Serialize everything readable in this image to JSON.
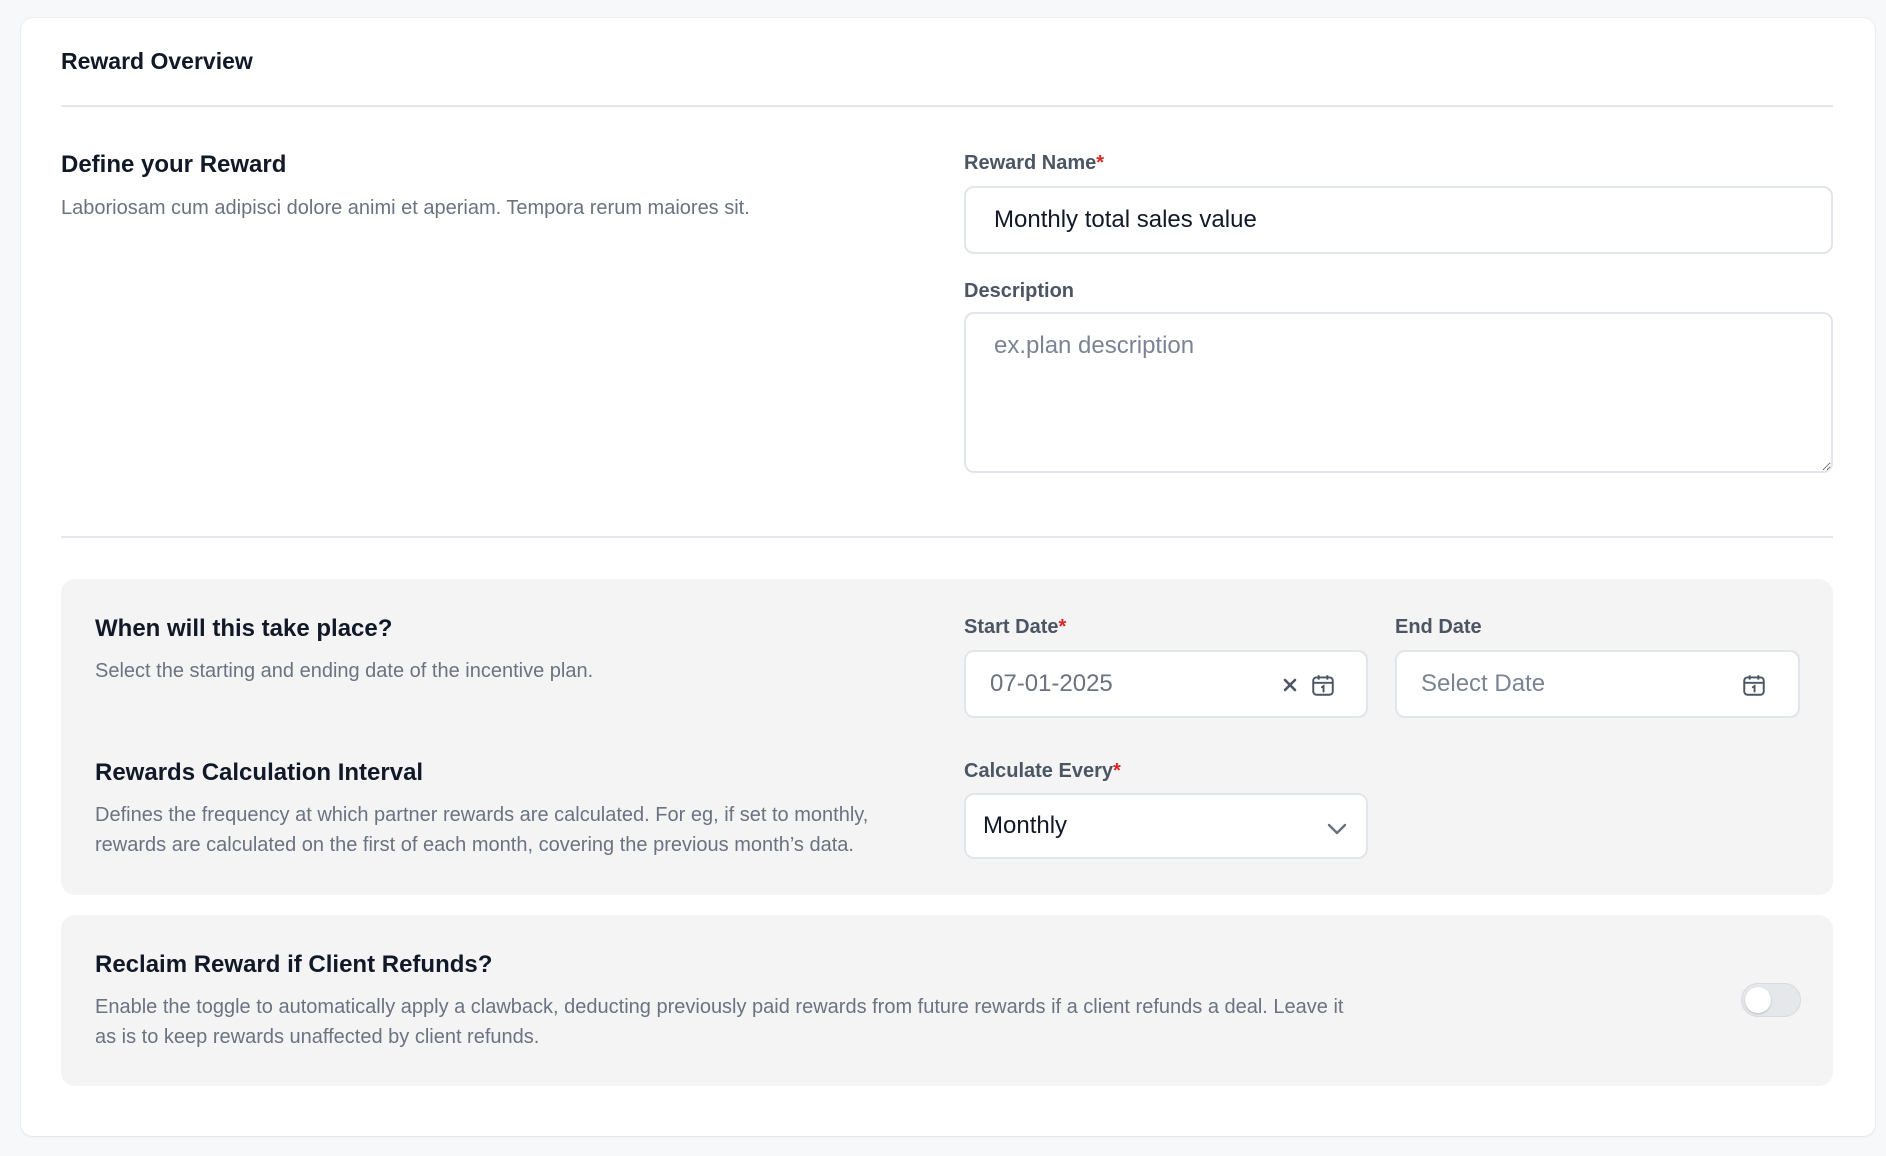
{
  "card": {
    "title": "Reward Overview"
  },
  "define": {
    "title": "Define your Reward",
    "description": "Laboriosam cum adipisci dolore animi et aperiam. Tempora rerum maiores sit.",
    "reward_name_label": "Reward Name",
    "reward_name_value": "Monthly total sales value",
    "description_label": "Description",
    "description_placeholder": "ex.plan description"
  },
  "schedule": {
    "title": "When will this take place?",
    "description": "Select the starting and ending date of the incentive plan.",
    "start_label": "Start Date",
    "start_value": "07-01-2025",
    "end_label": "End Date",
    "end_placeholder": "Select Date"
  },
  "interval": {
    "title": "Rewards Calculation Interval",
    "description_line1": "Defines the frequency at which partner rewards are calculated. For eg, if set to monthly,",
    "description_line2": "rewards are calculated on the first of each month, covering the previous month’s data.",
    "label": "Calculate Every",
    "selected": "Monthly"
  },
  "reclaim": {
    "title": "Reclaim Reward if Client Refunds?",
    "description_line1": "Enable the toggle to automatically apply a clawback, deducting previously paid rewards from future rewards if a client refunds a deal. Leave it",
    "description_line2": "as is to keep rewards unaffected by client refunds.",
    "enabled": false
  },
  "required_marker": "*",
  "colors": {
    "required": "#dc2626",
    "panel": "#f4f4f5",
    "border": "#e2e5ea",
    "muted_text": "#6b7280"
  }
}
